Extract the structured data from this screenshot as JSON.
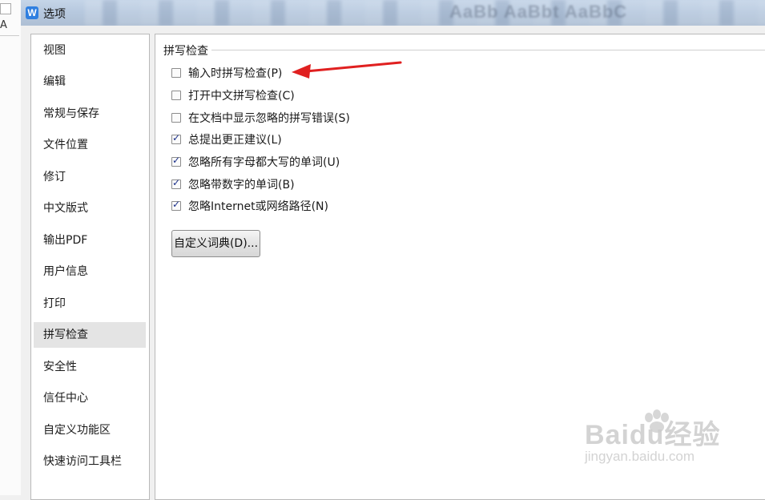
{
  "window": {
    "title": "选项",
    "app_icon": "W",
    "background_ribbon_text": "AaBb AaBbt AaBbC"
  },
  "nav": {
    "items": [
      {
        "label": "视图"
      },
      {
        "label": "编辑"
      },
      {
        "label": "常规与保存"
      },
      {
        "label": "文件位置"
      },
      {
        "label": "修订"
      },
      {
        "label": "中文版式"
      },
      {
        "label": "输出PDF"
      },
      {
        "label": "用户信息"
      },
      {
        "label": "打印"
      },
      {
        "label": "拼写检查",
        "selected": true
      },
      {
        "label": "安全性"
      },
      {
        "label": "信任中心"
      },
      {
        "label": "自定义功能区"
      },
      {
        "label": "快速访问工具栏"
      }
    ]
  },
  "spelling": {
    "group_title": "拼写检查",
    "options": [
      {
        "label": "输入时拼写检查(P)",
        "checked": false
      },
      {
        "label": "打开中文拼写检查(C)",
        "checked": false
      },
      {
        "label": "在文档中显示忽略的拼写错误(S)",
        "checked": false
      },
      {
        "label": "总提出更正建议(L)",
        "checked": true
      },
      {
        "label": "忽略所有字母都大写的单词(U)",
        "checked": true
      },
      {
        "label": "忽略带数字的单词(B)",
        "checked": true
      },
      {
        "label": "忽略Internet或网络路径(N)",
        "checked": true
      }
    ],
    "custom_dictionary_button": "自定义词典(D)..."
  },
  "annotation": {
    "arrow_color": "#e02020",
    "points_to": "输入时拼写检查(P)"
  },
  "watermark": {
    "main": "Baidu经验",
    "sub": "jingyan.baidu.com"
  }
}
